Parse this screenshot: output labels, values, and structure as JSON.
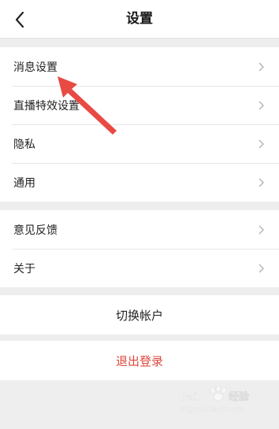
{
  "nav": {
    "title": "设置"
  },
  "group1": [
    {
      "label": "消息设置"
    },
    {
      "label": "直播特效设置"
    },
    {
      "label": "隐私"
    },
    {
      "label": "通用"
    }
  ],
  "group2": [
    {
      "label": "意见反馈"
    },
    {
      "label": "关于"
    }
  ],
  "switch_account": "切换帐户",
  "logout": "退出登录",
  "colors": {
    "logout": "#e0463a",
    "annotation_arrow": "#e84a44",
    "background": "#eeeeee"
  },
  "watermark": {
    "text": "Baidu 经验",
    "url": "jingyan.baidu.com"
  }
}
